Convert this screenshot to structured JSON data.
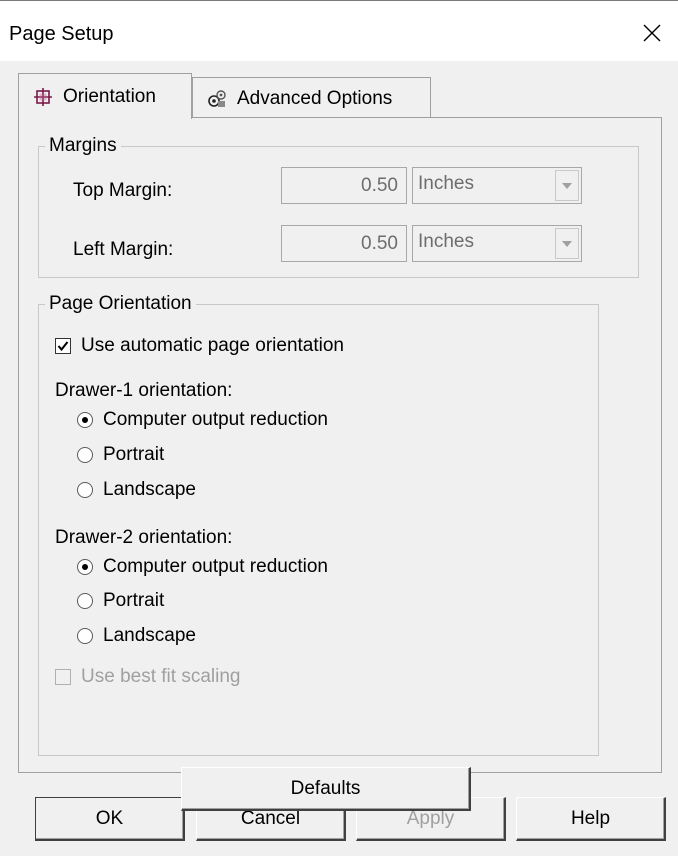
{
  "window": {
    "title": "Page Setup",
    "close_icon": "close-icon"
  },
  "tabs": [
    {
      "label": "Orientation",
      "icon": "orientation-icon",
      "active": true
    },
    {
      "label": "Advanced Options",
      "icon": "advanced-options-icon",
      "active": false
    }
  ],
  "margins": {
    "title": "Margins",
    "top": {
      "label": "Top Margin:",
      "value": "0.50",
      "unit": "Inches"
    },
    "left": {
      "label": "Left Margin:",
      "value": "0.50",
      "unit": "Inches"
    }
  },
  "page_orientation": {
    "title": "Page Orientation",
    "auto_checkbox": {
      "label": "Use automatic page orientation",
      "checked": true
    },
    "drawer1": {
      "label": "Drawer-1 orientation:",
      "options": [
        "Computer output reduction",
        "Portrait",
        "Landscape"
      ],
      "selected": "Computer output reduction"
    },
    "drawer2": {
      "label": "Drawer-2 orientation:",
      "options": [
        "Computer output reduction",
        "Portrait",
        "Landscape"
      ],
      "selected": "Computer output reduction"
    },
    "best_fit": {
      "label": "Use best fit scaling",
      "checked": false,
      "disabled": true
    }
  },
  "defaults_button": "Defaults",
  "buttons": {
    "ok": "OK",
    "cancel": "Cancel",
    "apply": "Apply",
    "help": "Help"
  }
}
